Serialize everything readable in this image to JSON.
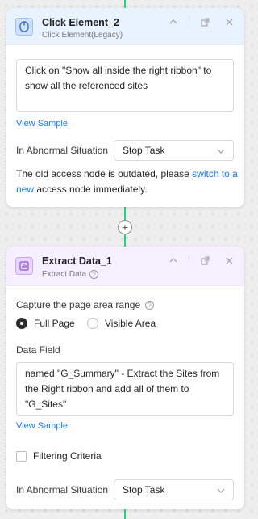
{
  "card1": {
    "title": "Click Element_2",
    "subtitle": "Click Element(Legacy)",
    "description": "Click on \"Show all inside the right ribbon\" to show all the referenced sites",
    "view_sample": "View Sample",
    "abnormal_label": "In Abnormal Situation",
    "abnormal_value": "Stop Task",
    "notice": {
      "prefix": "The old access node is outdated, please ",
      "link": "switch to a new",
      "suffix": " access node immediately."
    }
  },
  "add_node_symbol": "+",
  "card2": {
    "title": "Extract Data_1",
    "subtitle": "Extract Data",
    "capture_label": "Capture the page area range",
    "options": [
      "Full Page",
      "Visible Area"
    ],
    "selected_option": "Full Page",
    "data_field_label": "Data Field",
    "data_field_text": "named \"G_Summary\" - Extract the Sites from the Right ribbon and add all of them to \"G_Sites\"",
    "view_sample": "View Sample",
    "filter_label": "Filtering Criteria",
    "abnormal_label": "In Abnormal Situation",
    "abnormal_value": "Stop Task"
  },
  "colors": {
    "accent": "#1677ff",
    "connector": "#2fcf7a",
    "card1_header": "#e9f2ff",
    "card2_header": "#f6efff"
  },
  "icons": [
    "mouse-icon",
    "chart-icon",
    "chevron-up-icon",
    "open-external-icon",
    "close-icon",
    "help-icon",
    "chevron-down-icon",
    "plus-icon"
  ]
}
